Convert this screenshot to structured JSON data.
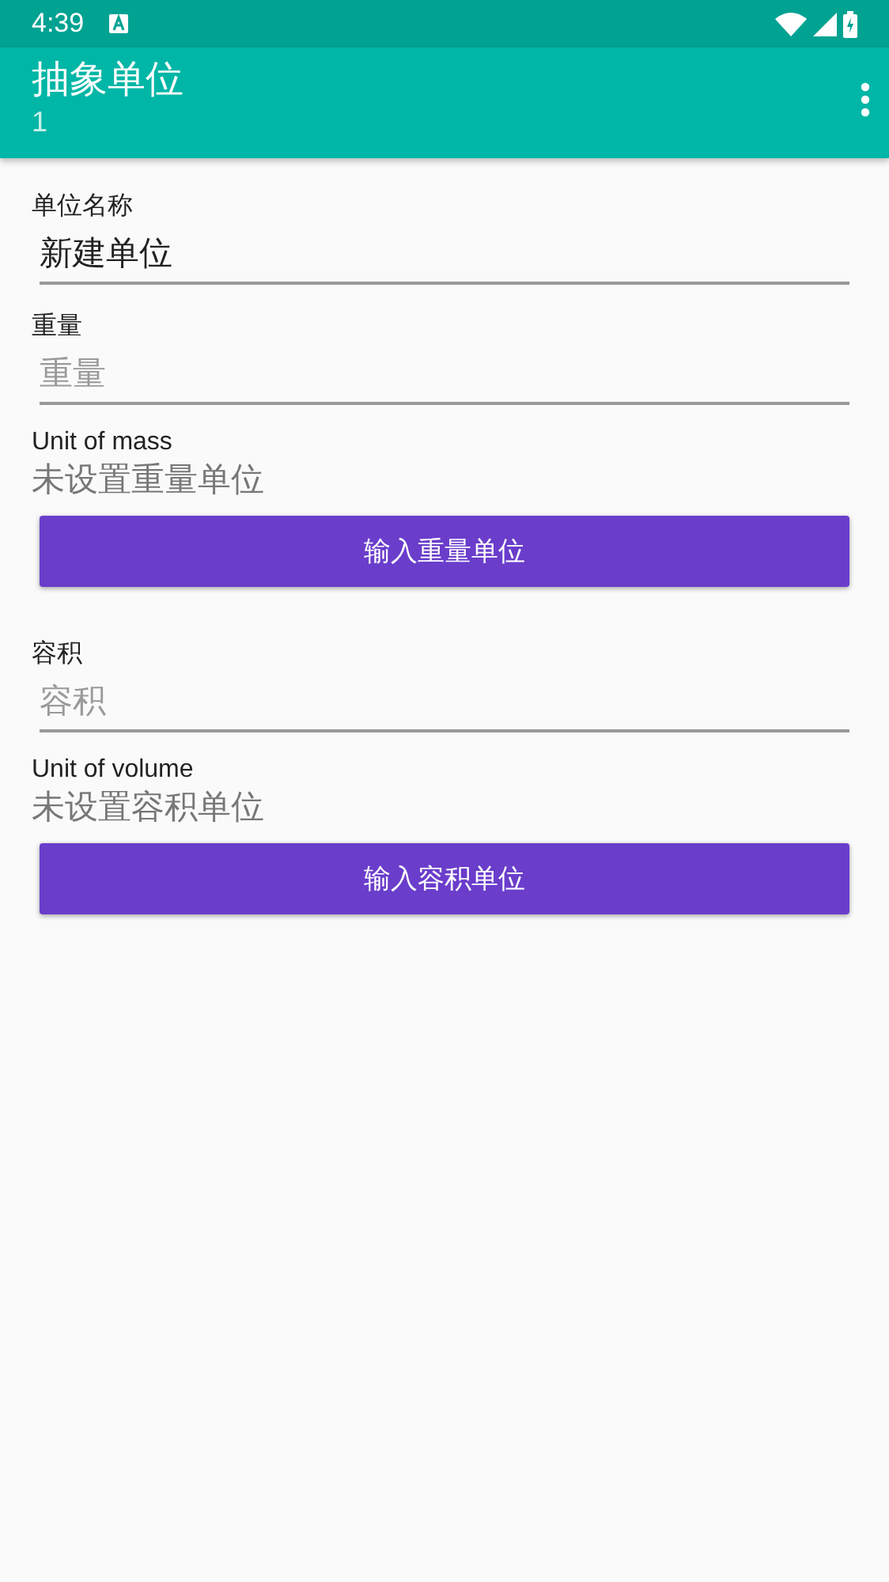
{
  "status_bar": {
    "time": "4:39"
  },
  "app_bar": {
    "title": "抽象单位",
    "subtitle": "1"
  },
  "form": [
    {
      "kind": "field",
      "label": "单位名称",
      "value": "新建单位"
    },
    {
      "kind": "field",
      "label": "重量",
      "placeholder": "重量"
    },
    {
      "kind": "unit",
      "caption": "Unit of mass",
      "status": "未设置重量单位",
      "button": "输入重量单位"
    },
    {
      "kind": "field",
      "label": "容积",
      "placeholder": "容积"
    },
    {
      "kind": "unit",
      "caption": "Unit of volume",
      "status": "未设置容积单位",
      "button": "输入容积单位"
    }
  ]
}
